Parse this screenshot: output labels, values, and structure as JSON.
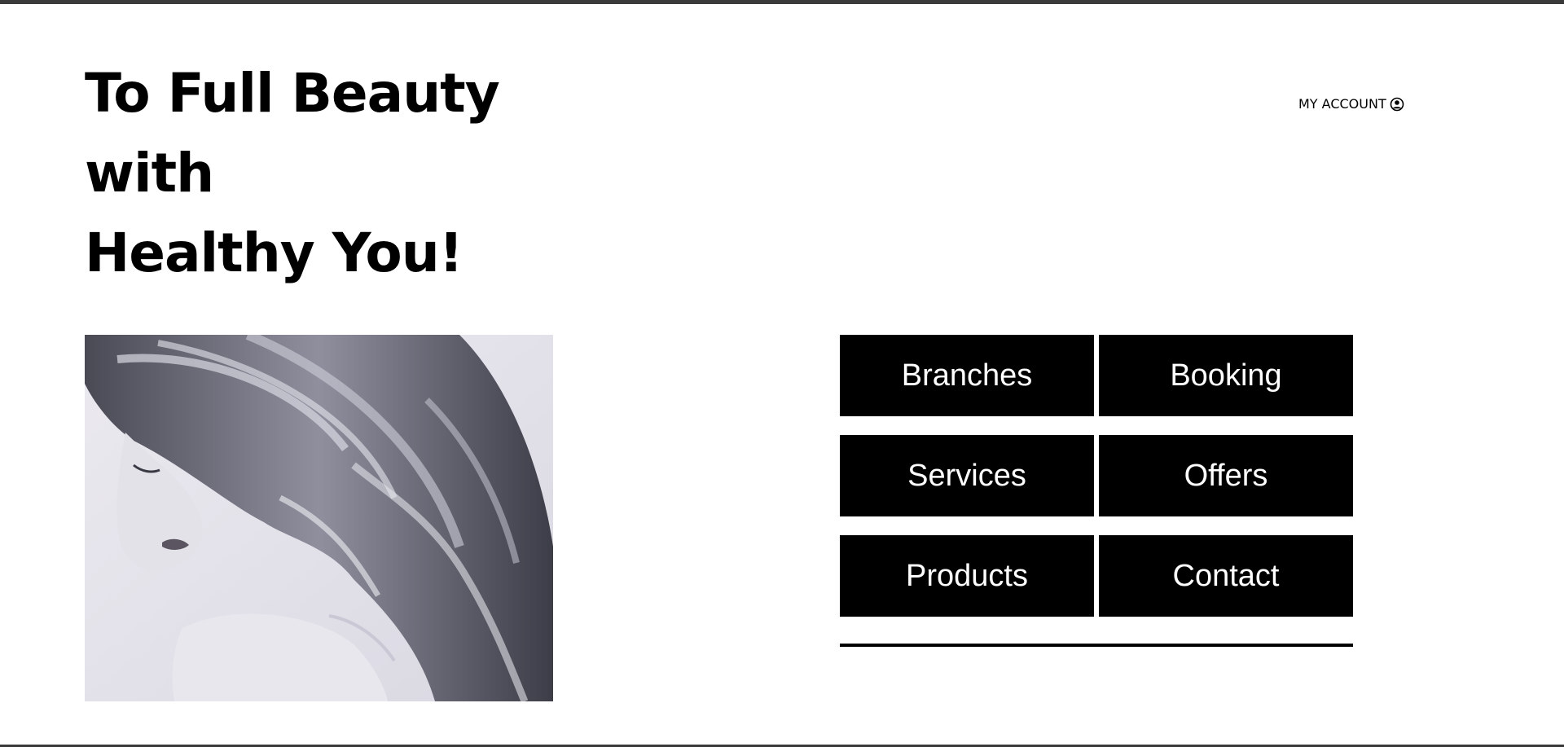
{
  "hero": {
    "title_lines": [
      "To Full Beauty",
      "with",
      "Healthy You!"
    ]
  },
  "account": {
    "label": "MY ACCOUNT",
    "icon": "user-circle-icon"
  },
  "image": {
    "subject": "hair-model-photo"
  },
  "nav": {
    "items": [
      {
        "label": "Branches"
      },
      {
        "label": "Booking"
      },
      {
        "label": "Services"
      },
      {
        "label": "Offers"
      },
      {
        "label": "Products"
      },
      {
        "label": "Contact"
      }
    ]
  },
  "colors": {
    "button_bg": "#000000",
    "button_text": "#ffffff",
    "top_bar": "#3a3a3a",
    "background": "#ffffff"
  }
}
